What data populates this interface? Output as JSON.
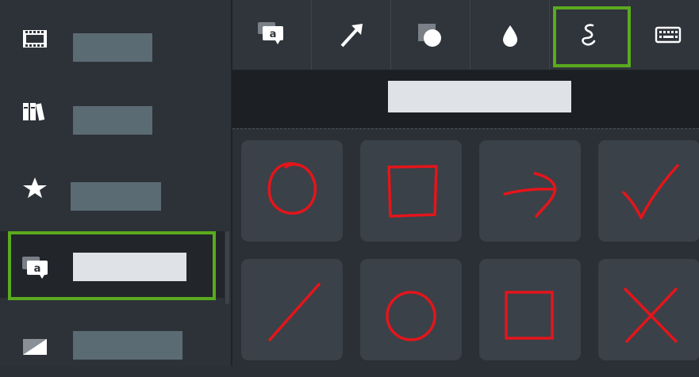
{
  "colors": {
    "accent_green": "#5aaa1e",
    "annotation_red": "#e4151b",
    "label_placeholder": "#5b6b73",
    "active_label": "#dfe3e8"
  },
  "sidebar": {
    "items": [
      {
        "icon": "film-strip-icon",
        "label": "",
        "active": false
      },
      {
        "icon": "library-books-icon",
        "label": "",
        "active": false
      },
      {
        "icon": "star-icon",
        "label": "",
        "active": false
      },
      {
        "icon": "callout-a-icon",
        "label": "",
        "active": true
      },
      {
        "icon": "gradient-square-icon",
        "label": "",
        "active": false
      }
    ]
  },
  "toolbar": {
    "tools": [
      {
        "icon": "callout-a-icon",
        "selected": false
      },
      {
        "icon": "arrow-icon",
        "selected": false
      },
      {
        "icon": "shape-overlap-icon",
        "selected": false
      },
      {
        "icon": "blur-drop-icon",
        "selected": false
      },
      {
        "icon": "squiggle-sketch-icon",
        "selected": true
      },
      {
        "icon": "keyboard-icon",
        "selected": false
      }
    ]
  },
  "panel": {
    "title": ""
  },
  "shapes": [
    {
      "name": "sketch-circle-icon"
    },
    {
      "name": "sketch-square-icon"
    },
    {
      "name": "sketch-arrow-icon"
    },
    {
      "name": "sketch-checkmark-icon"
    },
    {
      "name": "sketch-line-icon"
    },
    {
      "name": "sketch-circle-icon"
    },
    {
      "name": "sketch-square-icon"
    },
    {
      "name": "sketch-x-icon"
    }
  ]
}
